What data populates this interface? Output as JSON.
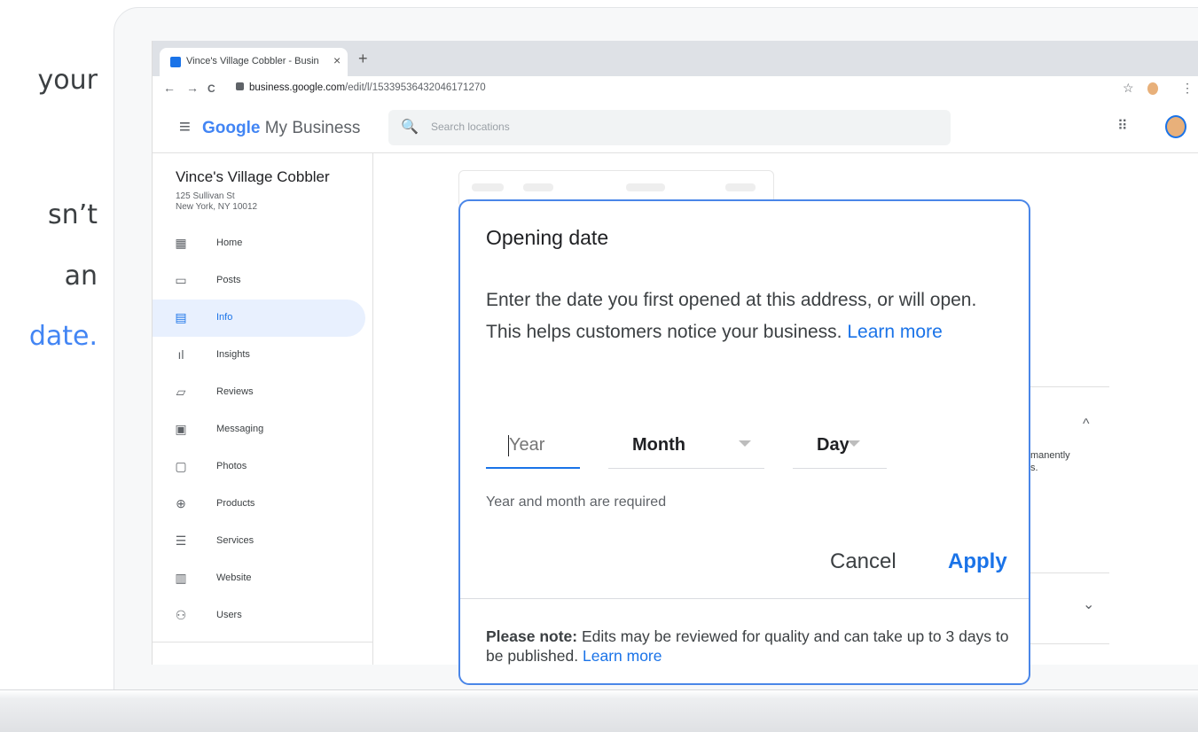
{
  "marketing_text": {
    "line1": "your",
    "line2": "sn’t",
    "line3": "an",
    "line4": "date."
  },
  "browser": {
    "tab_title": "Vince's Village Cobbler - Busin",
    "tab_close": "×",
    "new_tab": "+",
    "nav_back": "←",
    "nav_forward": "→",
    "nav_reload": "C",
    "url_domain": "business.google.com",
    "url_path": "/edit/l/15339536432046171270",
    "star": "☆",
    "menu": "⋮"
  },
  "app": {
    "hamburger": "≡",
    "logo_google": "Google",
    "logo_suffix": " My Business",
    "search_icon": "🔍",
    "search_placeholder": "Search locations",
    "apps_icon": "⠿"
  },
  "sidebar": {
    "business_name": "Vince's Village Cobbler",
    "address_line1": "125 Sullivan St",
    "address_line2": "New York, NY 10012",
    "items": [
      {
        "label": "Home",
        "icon": "▦"
      },
      {
        "label": "Posts",
        "icon": "▭"
      },
      {
        "label": "Info",
        "icon": "▤"
      },
      {
        "label": "Insights",
        "icon": "ıl"
      },
      {
        "label": "Reviews",
        "icon": "▱"
      },
      {
        "label": "Messaging",
        "icon": "▣"
      },
      {
        "label": "Photos",
        "icon": "▢"
      },
      {
        "label": "Products",
        "icon": "⊕"
      },
      {
        "label": "Services",
        "icon": "☰"
      },
      {
        "label": "Website",
        "icon": "▥"
      },
      {
        "label": "Users",
        "icon": "⚇"
      }
    ]
  },
  "background": {
    "partial_text1": "manently",
    "partial_text2": "s.",
    "chevron_up": "^",
    "chevron_down": "⌄"
  },
  "dialog": {
    "title": "Opening date",
    "body": "Enter the date you first opened at this address, or will open. This helps customers notice your business.",
    "learn_more": "Learn more",
    "year_placeholder": "Year",
    "month_label": "Month",
    "day_label": "Day",
    "hint": "Year and month are required",
    "cancel": "Cancel",
    "apply": "Apply",
    "note_bold": "Please note:",
    "note_text": "Edits may be reviewed for quality and can take up to 3 days to be published.",
    "note_link": "Learn more"
  },
  "colors": {
    "accent": "#1a73e8",
    "dialog_border": "#4a86e8",
    "active_nav_bg": "#e8f0fe"
  }
}
